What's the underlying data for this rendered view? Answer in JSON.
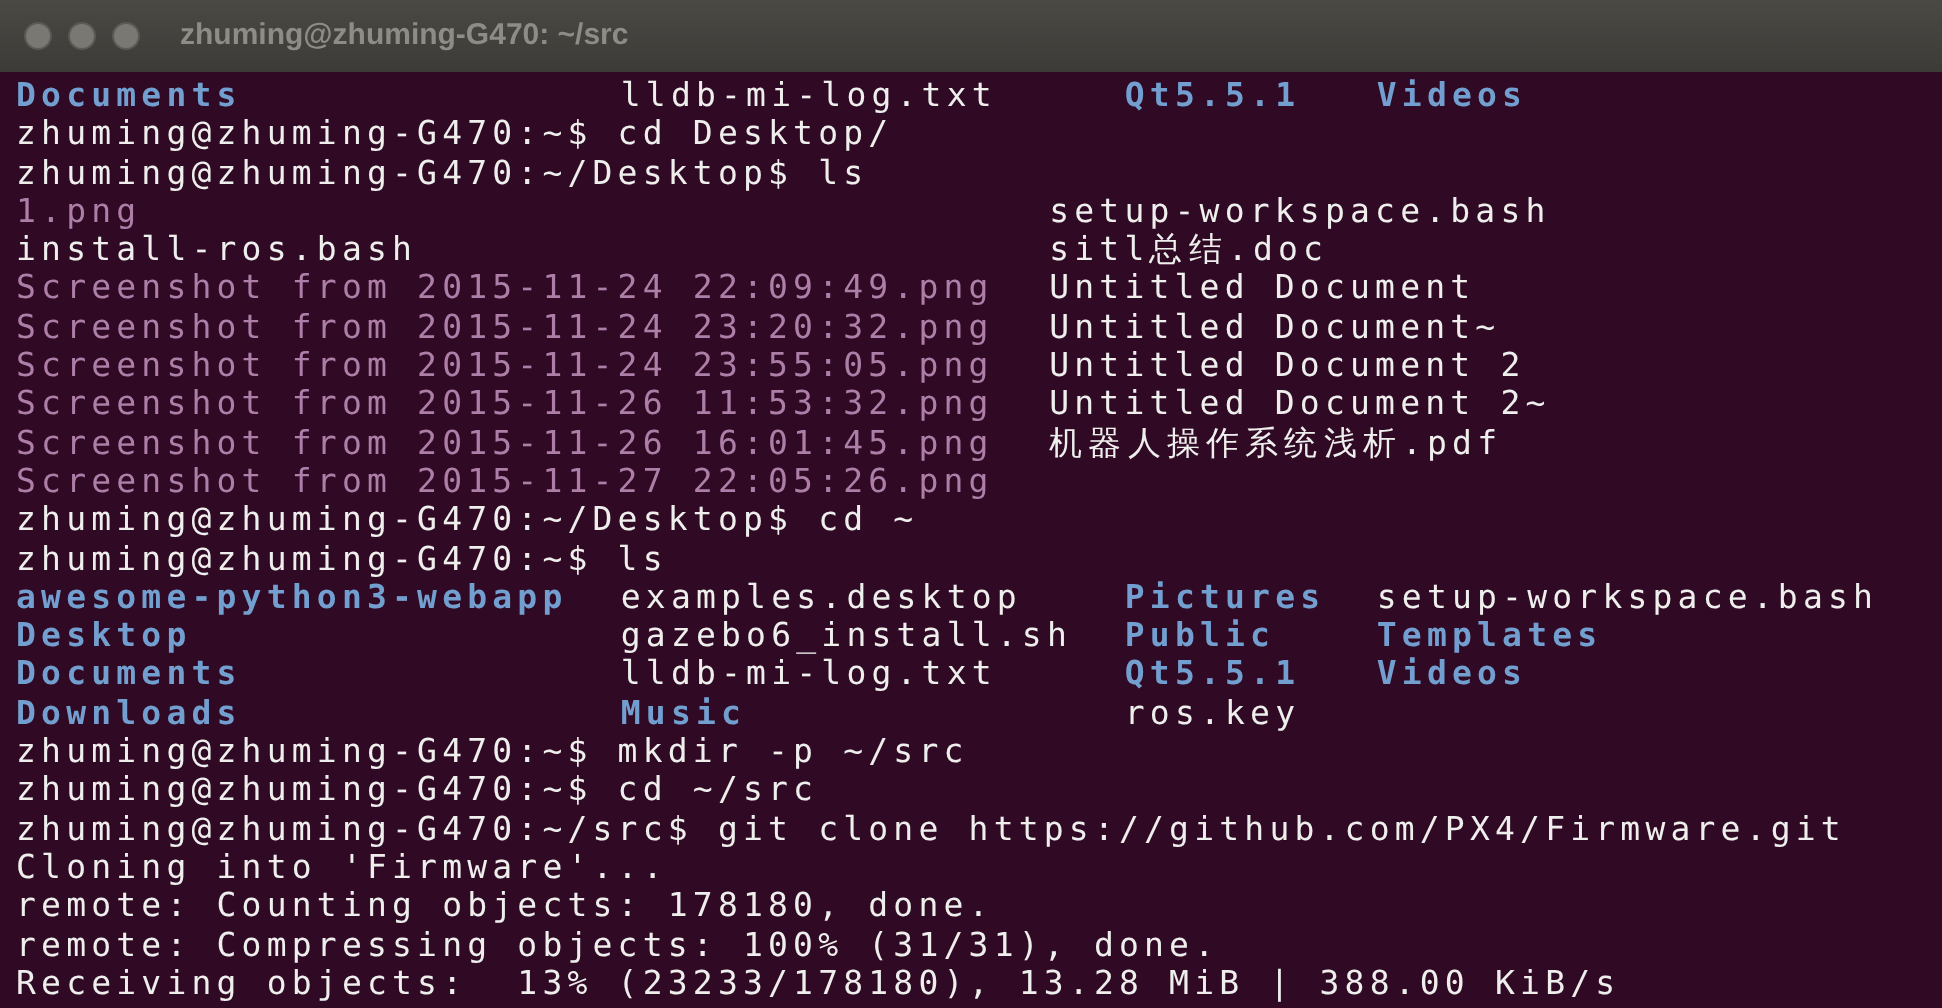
{
  "window": {
    "title": "zhuming@zhuming-G470: ~/src"
  },
  "blocks": [
    {
      "kind": "listing",
      "rows": [
        [
          {
            "text": "Documents",
            "kind": "dir"
          },
          {
            "text": "lldb-mi-log.txt",
            "kind": "file"
          },
          {
            "text": "Qt5.5.1",
            "kind": "dir"
          },
          {
            "text": "Videos",
            "kind": "dir"
          }
        ]
      ]
    },
    {
      "kind": "line",
      "text": "zhuming@zhuming-G470:~$ cd Desktop/"
    },
    {
      "kind": "line",
      "text": "zhuming@zhuming-G470:~/Desktop$ ls"
    },
    {
      "kind": "listing",
      "rows": [
        [
          {
            "text": "1.png",
            "kind": "image"
          },
          {
            "text": "setup-workspace.bash",
            "kind": "file"
          }
        ],
        [
          {
            "text": "install-ros.bash",
            "kind": "file"
          },
          {
            "text": "sitl总结.doc",
            "kind": "file"
          }
        ],
        [
          {
            "text": "Screenshot from 2015-11-24 22:09:49.png",
            "kind": "image"
          },
          {
            "text": "Untitled Document",
            "kind": "file"
          }
        ],
        [
          {
            "text": "Screenshot from 2015-11-24 23:20:32.png",
            "kind": "image"
          },
          {
            "text": "Untitled Document~",
            "kind": "file"
          }
        ],
        [
          {
            "text": "Screenshot from 2015-11-24 23:55:05.png",
            "kind": "image"
          },
          {
            "text": "Untitled Document 2",
            "kind": "file"
          }
        ],
        [
          {
            "text": "Screenshot from 2015-11-26 11:53:32.png",
            "kind": "image"
          },
          {
            "text": "Untitled Document 2~",
            "kind": "file"
          }
        ],
        [
          {
            "text": "Screenshot from 2015-11-26 16:01:45.png",
            "kind": "image"
          },
          {
            "text": "机器人操作系统浅析.pdf",
            "kind": "file"
          }
        ],
        [
          {
            "text": "Screenshot from 2015-11-27 22:05:26.png",
            "kind": "image"
          }
        ]
      ]
    },
    {
      "kind": "line",
      "text": "zhuming@zhuming-G470:~/Desktop$ cd ~"
    },
    {
      "kind": "line",
      "text": "zhuming@zhuming-G470:~$ ls"
    },
    {
      "kind": "listing",
      "rows": [
        [
          {
            "text": "awesome-python3-webapp",
            "kind": "dir"
          },
          {
            "text": "examples.desktop",
            "kind": "file"
          },
          {
            "text": "Pictures",
            "kind": "dir"
          },
          {
            "text": "setup-workspace.bash",
            "kind": "file"
          }
        ],
        [
          {
            "text": "Desktop",
            "kind": "dir"
          },
          {
            "text": "gazebo6_install.sh",
            "kind": "file"
          },
          {
            "text": "Public",
            "kind": "dir"
          },
          {
            "text": "Templates",
            "kind": "dir"
          }
        ],
        [
          {
            "text": "Documents",
            "kind": "dir"
          },
          {
            "text": "lldb-mi-log.txt",
            "kind": "file"
          },
          {
            "text": "Qt5.5.1",
            "kind": "dir"
          },
          {
            "text": "Videos",
            "kind": "dir"
          }
        ],
        [
          {
            "text": "Downloads",
            "kind": "dir"
          },
          {
            "text": "Music",
            "kind": "dir"
          },
          {
            "text": "ros.key",
            "kind": "file"
          }
        ]
      ]
    },
    {
      "kind": "line",
      "text": "zhuming@zhuming-G470:~$ mkdir -p ~/src"
    },
    {
      "kind": "line",
      "text": "zhuming@zhuming-G470:~$ cd ~/src"
    },
    {
      "kind": "line",
      "text": "zhuming@zhuming-G470:~/src$ git clone https://github.com/PX4/Firmware.git"
    },
    {
      "kind": "line",
      "text": "Cloning into 'Firmware'..."
    },
    {
      "kind": "line",
      "text": "remote: Counting objects: 178180, done."
    },
    {
      "kind": "line",
      "text": "remote: Compressing objects: 100% (31/31), done."
    },
    {
      "kind": "line",
      "text": "Receiving objects:  13% (23233/178180), 13.28 MiB | 388.00 KiB/s"
    }
  ]
}
